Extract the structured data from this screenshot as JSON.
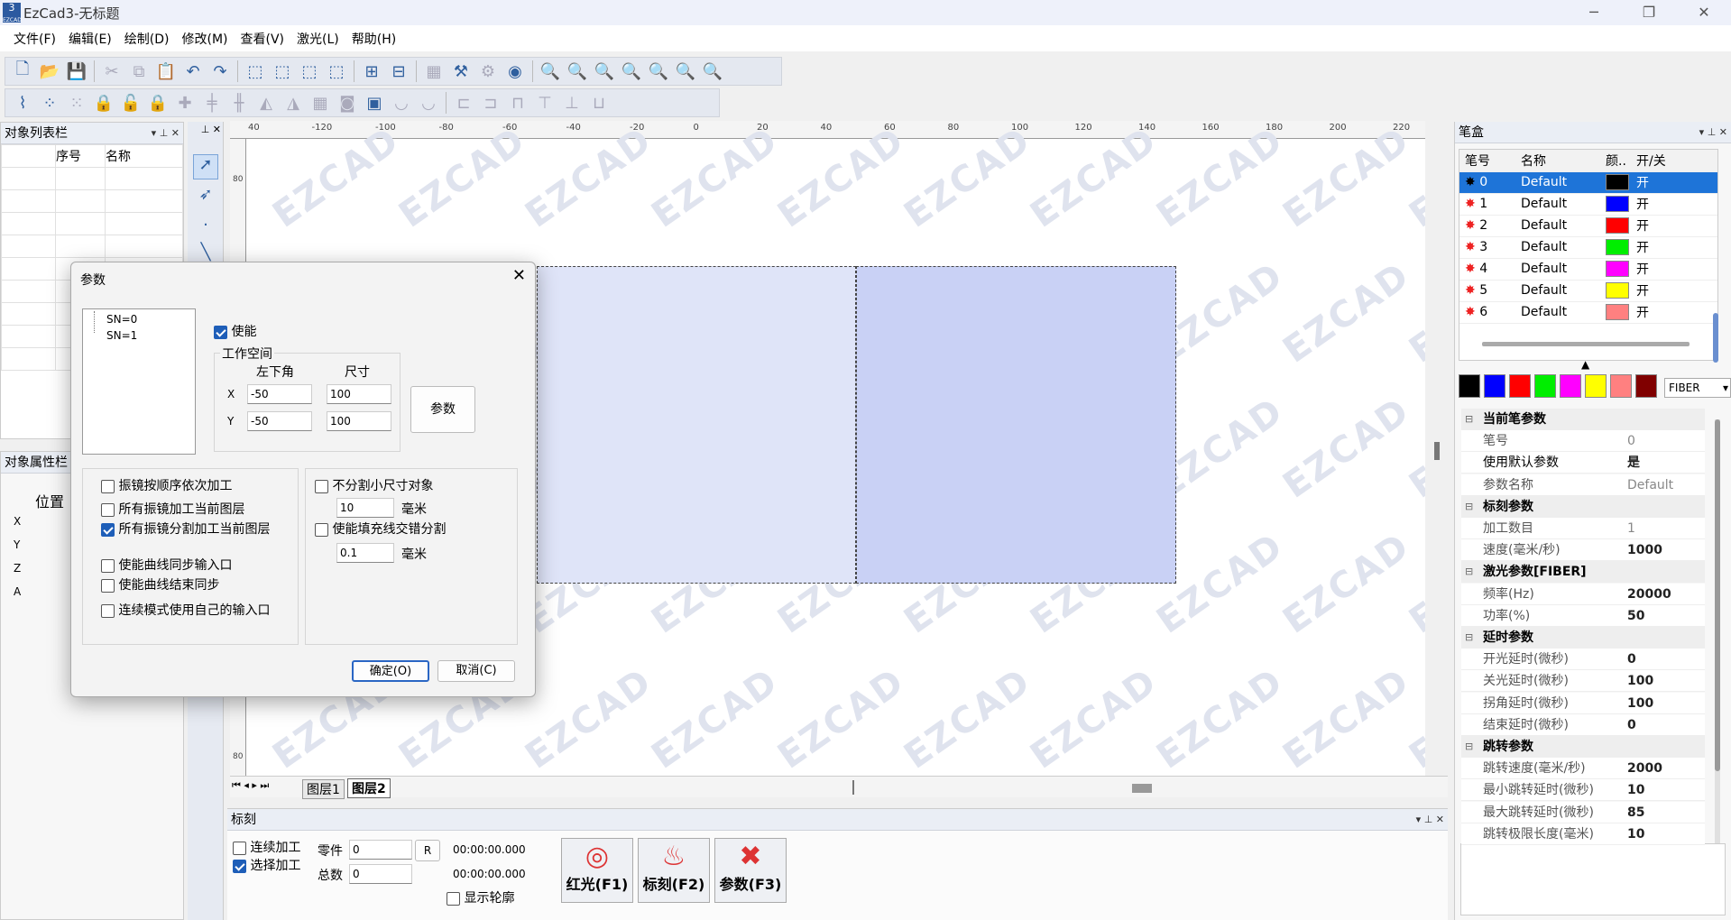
{
  "window": {
    "title": "EzCad3-无标题",
    "logo": "3",
    "controls": [
      "minimize-icon",
      "restore-icon",
      "close-icon"
    ]
  },
  "menu": [
    "文件(F)",
    "编辑(E)",
    "绘制(D)",
    "修改(M)",
    "查看(V)",
    "激光(L)",
    "帮助(H)"
  ],
  "object_list": {
    "title": "对象列表栏",
    "cols": [
      "序号",
      "名称"
    ]
  },
  "object_props": {
    "title": "对象属性栏",
    "position_label": "位置",
    "axes": [
      "X",
      "Y",
      "Z",
      "A"
    ]
  },
  "layers": {
    "tabs": [
      "图层1",
      "图层2"
    ],
    "active": "图层2"
  },
  "ruler": {
    "top": [
      "40",
      "-120",
      "-100",
      "-80",
      "-60",
      "-40",
      "-20",
      "0",
      "20",
      "40",
      "60",
      "80",
      "100",
      "120",
      "140",
      "160",
      "180",
      "200",
      "220"
    ]
  },
  "watermark": "EZCAD",
  "dialog": {
    "title": "参数",
    "tree": [
      "SN=0",
      "SN=1"
    ],
    "enable": {
      "label": "使能",
      "checked": true
    },
    "workspace": {
      "title": "工作空间",
      "col1": "左下角",
      "col2": "尺寸",
      "x_label": "X",
      "y_label": "Y",
      "x_corner": "-50",
      "x_size": "100",
      "y_corner": "-50",
      "y_size": "100"
    },
    "param_button": "参数",
    "left_options": [
      {
        "label": "振镜按顺序依次加工",
        "checked": false
      },
      {
        "label": "所有振镜加工当前图层",
        "checked": false
      },
      {
        "label": "所有振镜分割加工当前图层",
        "checked": true
      },
      {
        "label": "使能曲线同步输入口",
        "checked": false
      },
      {
        "label": "使能曲线结束同步",
        "checked": false
      },
      {
        "label": "连续模式使用自己的输入口",
        "checked": false
      }
    ],
    "right_options": [
      {
        "label": "不分割小尺寸对象",
        "checked": false,
        "value": "10",
        "unit": "毫米"
      },
      {
        "label": "使能填充线交错分割",
        "checked": false,
        "value": "0.1",
        "unit": "毫米"
      }
    ],
    "ok": "确定(O)",
    "cancel": "取消(C)"
  },
  "pen_box": {
    "title": "笔盒",
    "cols": [
      "笔号",
      "名称",
      "颜..",
      "开/关"
    ],
    "pens": [
      {
        "no": "0",
        "name": "Default",
        "color": "#000000",
        "on": "开"
      },
      {
        "no": "1",
        "name": "Default",
        "color": "#0000ff",
        "on": "开"
      },
      {
        "no": "2",
        "name": "Default",
        "color": "#ff0000",
        "on": "开"
      },
      {
        "no": "3",
        "name": "Default",
        "color": "#00ee00",
        "on": "开"
      },
      {
        "no": "4",
        "name": "Default",
        "color": "#ff00ff",
        "on": "开"
      },
      {
        "no": "5",
        "name": "Default",
        "color": "#ffff00",
        "on": "开"
      },
      {
        "no": "6",
        "name": "Default",
        "color": "#ff8080",
        "on": "开"
      }
    ],
    "swatches": [
      "#000000",
      "#0000ff",
      "#ff0000",
      "#00ee00",
      "#ff00ff",
      "#ffff00",
      "#ff8080",
      "#800000"
    ],
    "laser_type": "FIBER"
  },
  "pen_params": [
    {
      "section": "当前笔参数"
    },
    {
      "k": "笔号",
      "v": "0",
      "grey": true
    },
    {
      "k": "使用默认参数",
      "v": "是",
      "dark": true
    },
    {
      "k": "参数名称",
      "v": "Default",
      "grey": true
    },
    {
      "section": "标刻参数"
    },
    {
      "k": "加工数目",
      "v": "1",
      "grey": true
    },
    {
      "k": "速度(毫米/秒)",
      "v": "1000"
    },
    {
      "section": "激光参数[FIBER]"
    },
    {
      "k": "频率(Hz)",
      "v": "20000"
    },
    {
      "k": "功率(%)",
      "v": "50"
    },
    {
      "section": "延时参数"
    },
    {
      "k": "开光延时(微秒)",
      "v": "0"
    },
    {
      "k": "关光延时(微秒)",
      "v": "100"
    },
    {
      "k": "拐角延时(微秒)",
      "v": "100"
    },
    {
      "k": "结束延时(微秒)",
      "v": "0"
    },
    {
      "section": "跳转参数"
    },
    {
      "k": "跳转速度(毫米/秒)",
      "v": "2000"
    },
    {
      "k": "最小跳转延时(微秒)",
      "v": "10"
    },
    {
      "k": "最大跳转延时(微秒)",
      "v": "85"
    },
    {
      "k": "跳转极限长度(毫米)",
      "v": "10"
    }
  ],
  "mark": {
    "title": "标刻",
    "continuous": {
      "label": "连续加工",
      "checked": false
    },
    "select": {
      "label": "选择加工",
      "checked": true
    },
    "part_label": "零件",
    "part_value": "0",
    "r_button": "R",
    "total_label": "总数",
    "total_value": "0",
    "time1": "00:00:00.000",
    "time2": "00:00:00.000",
    "outline": {
      "label": "显示轮廓",
      "checked": false
    },
    "red_light": "红光(F1)",
    "mark_btn": "标刻(F2)",
    "param_btn": "参数(F3)"
  }
}
